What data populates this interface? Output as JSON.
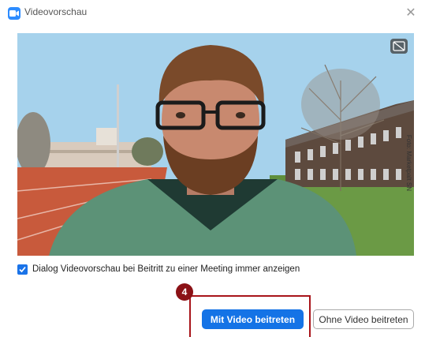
{
  "window": {
    "title": "Videovorschau",
    "close_icon": "close-icon"
  },
  "video": {
    "watermark": "Foto: Marketpalt SN",
    "camera_toggle_icon": "camera-off-icon"
  },
  "options": {
    "always_show_preview_label": "Dialog Videovorschau bei Beitritt zu einer Meeting immer anzeigen",
    "always_show_preview_checked": true
  },
  "actions": {
    "join_with_video_label": "Mit Video beitreten",
    "join_without_video_label": "Ohne Video beitreten"
  },
  "annotation": {
    "step_number": "4",
    "color": "#a8141a"
  },
  "colors": {
    "accent": "#1473e6",
    "checkbox": "#1a73e8",
    "app_icon": "#2d8cff"
  }
}
